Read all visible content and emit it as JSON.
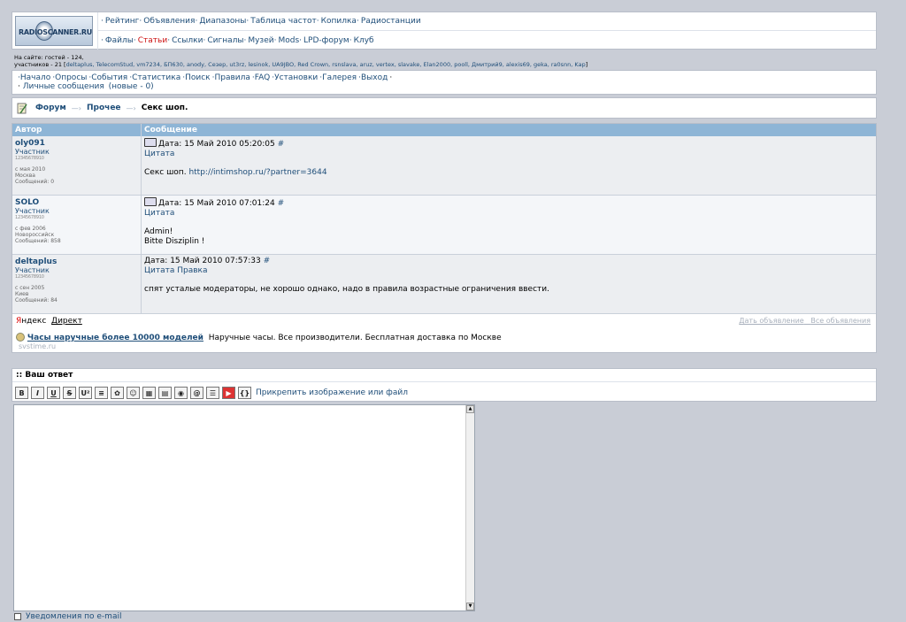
{
  "topnav": {
    "logo_text": "RADIOSCANNER.RU",
    "row1": [
      "Рейтинг",
      "Объявления",
      "Диапазоны",
      "Таблица частот",
      "Копилка",
      "Радиостанции"
    ],
    "row2": [
      "Файлы",
      "Статьи",
      "Ссылки",
      "Сигналы",
      "Музей",
      "Mods",
      "LPD-форум",
      "Клуб"
    ]
  },
  "online": {
    "line1": "На сайте: гостей - 124,",
    "line2_prefix": "участников - 21 [",
    "names": "deltaplus, TelecomStud, vm7234, БП630, anody, Сезер, ut3rz, lesinok, UA9JBO, Red Crown, rsnslava, aruz, vertex, slavake, Elan2000, pooll, Дмитрий9, alexis69, geka, ra0snn, Kap",
    "line2_suffix": "]"
  },
  "menu": {
    "items": [
      "Начало",
      "Опросы",
      "События",
      "Статистика",
      "Поиск",
      "Правила",
      "FAQ",
      "Установки",
      "Галерея",
      "Выход"
    ],
    "pm_label": "Личные сообщения",
    "pm_count": "(новые - 0)"
  },
  "breadcrumb": {
    "forum": "Форум",
    "section": "Прочее",
    "topic": "Секс шоп."
  },
  "table": {
    "col_author": "Автор",
    "col_message": "Сообщение"
  },
  "posts": [
    {
      "author": "oly091",
      "role": "Участник",
      "bar": "12345678910",
      "since": "с мая 2010",
      "city": "Москва",
      "count": "Сообщений: 0",
      "date": "Дата: 15 Май 2010 05:20:05",
      "anchor": "#",
      "quote": "Цитата",
      "edit": "",
      "body1": "Секс шоп.",
      "link": "http://intimshop.ru/?partner=3644",
      "body2": ""
    },
    {
      "author": "SOLO",
      "role": "Участник",
      "bar": "12345678910",
      "since": "с фев 2006",
      "city": "Новороссийск",
      "count": "Сообщений: 858",
      "date": "Дата: 15 Май 2010 07:01:24",
      "anchor": "#",
      "quote": "Цитата",
      "edit": "",
      "body1": "Admin!",
      "link": "",
      "body2": "Bitte Disziplin !"
    },
    {
      "author": "deltaplus",
      "role": "Участник",
      "bar": "12345678910",
      "since": "с сен 2005",
      "city": "Киев",
      "count": "Сообщений: 84",
      "date": "Дата: 15 Май 2010 07:57:33",
      "anchor": "#",
      "quote": "Цитата",
      "edit": "Правка",
      "body1": "спят усталые модераторы, не хорошо однако, надо в правила возрастные ограничения ввести.",
      "link": "",
      "body2": ""
    }
  ],
  "ads": {
    "yandex_y": "Я",
    "yandex_rest": "ндекс",
    "direct": "Директ",
    "give_ad": "Дать объявление",
    "all_ads": "Все объявления",
    "ad_title": "Часы наручные более 10000 моделей",
    "ad_text": "Наручные часы. Все производители. Бесплатная доставка по Москве",
    "ad_host": "svstime.ru"
  },
  "reply": {
    "header": ":: Ваш ответ",
    "toolbar": [
      "B",
      "I",
      "U",
      "S",
      "U²",
      "≡",
      "✿",
      "☺",
      "▦",
      "▤",
      "◉",
      "@",
      "☰",
      "▶",
      "{}"
    ],
    "attach": "Прикрепить изображение или файл",
    "notify": "Уведомления по e-mail"
  }
}
